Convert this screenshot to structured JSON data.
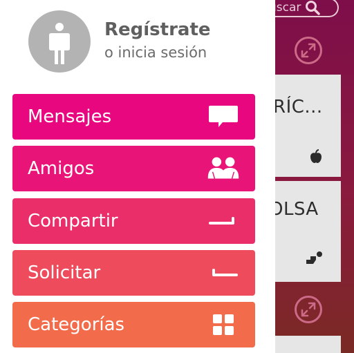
{
  "header": {
    "register_title": "Regístrate",
    "login_subtitle": "o inicia sesión"
  },
  "menu": [
    {
      "label": "Mensajes",
      "icon": "message-icon",
      "color": "#e8077f"
    },
    {
      "label": "Amigos",
      "icon": "friends-icon",
      "color": "#e81477"
    },
    {
      "label": "Compartir",
      "icon": "share-arrow-icon",
      "color": "#ea2e6a"
    },
    {
      "label": "Solicitar",
      "icon": "request-arrow-icon",
      "color": "#ee4c5c"
    },
    {
      "label": "Categorías",
      "icon": "grid-icon",
      "color": "#f26c4b"
    }
  ],
  "background": {
    "search_label": "uscar",
    "card1_title": "RÍC...",
    "card2_title": "OLSA",
    "colors": {
      "top": "#7d0e4a",
      "bottom": "#7a2a24"
    }
  }
}
